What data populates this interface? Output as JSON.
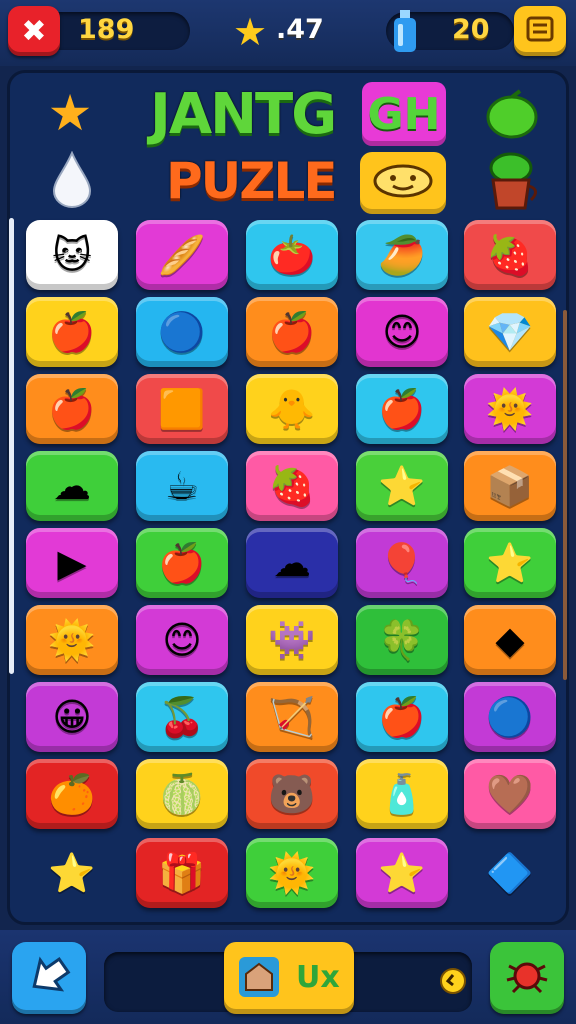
{
  "hud": {
    "coins": "189",
    "stars": ".47",
    "potions": "20",
    "close_icon": "close-x-icon",
    "menu_icon": "menu-icon"
  },
  "title": {
    "line1": "JANTG",
    "line1_box": "GH",
    "line2": "PUZLE"
  },
  "decor": [
    "star-leaf-icon",
    "teardrop-icon",
    "green-fruit-icon",
    "potted-plant-icon",
    "smile-face-badge-icon"
  ],
  "grid": [
    [
      {
        "color": "#ffffff",
        "icon": "cat-face",
        "g": "🐱"
      },
      {
        "color": "#e23ad6",
        "icon": "bread",
        "g": "🥖"
      },
      {
        "color": "#2fc6ee",
        "icon": "tomato",
        "g": "🍅"
      },
      {
        "color": "#37c7ef",
        "icon": "mango",
        "g": "🥭"
      },
      {
        "color": "#f04a4a",
        "icon": "strawberry",
        "g": "🍓"
      }
    ],
    [
      {
        "color": "#ffd21c",
        "icon": "apple",
        "g": "🍎"
      },
      {
        "color": "#25b6f0",
        "icon": "blue-orb",
        "g": "🔵"
      },
      {
        "color": "#ff8d1c",
        "icon": "apple",
        "g": "🍎"
      },
      {
        "color": "#e235d0",
        "icon": "smiley",
        "g": "😊"
      },
      {
        "color": "#ffc11c",
        "icon": "gem",
        "g": "💎"
      }
    ],
    [
      {
        "color": "#ff8d1c",
        "icon": "apple",
        "g": "🍎"
      },
      {
        "color": "#f04a4a",
        "icon": "card",
        "g": "🟧"
      },
      {
        "color": "#ffd21c",
        "icon": "chick",
        "g": "🐥"
      },
      {
        "color": "#2fc6ee",
        "icon": "apple",
        "g": "🍎"
      },
      {
        "color": "#d33ad6",
        "icon": "sun-face",
        "g": "🌞"
      }
    ],
    [
      {
        "color": "#3fcf3a",
        "icon": "cloud",
        "g": "☁"
      },
      {
        "color": "#29baf0",
        "icon": "mug",
        "g": "☕"
      },
      {
        "color": "#ff5aa5",
        "icon": "strawberry",
        "g": "🍓"
      },
      {
        "color": "#49d03a",
        "icon": "star",
        "g": "⭐"
      },
      {
        "color": "#ff8d1c",
        "icon": "box",
        "g": "📦"
      }
    ],
    [
      {
        "color": "#e23ad6",
        "icon": "arrow",
        "g": "▶"
      },
      {
        "color": "#3fcf3a",
        "icon": "apple",
        "g": "🍎"
      },
      {
        "color": "#2a2fa8",
        "icon": "cloud",
        "g": "☁"
      },
      {
        "color": "#c23ad6",
        "icon": "balloon",
        "g": "🎈"
      },
      {
        "color": "#3fcf3a",
        "icon": "star",
        "g": "⭐"
      }
    ],
    [
      {
        "color": "#ff8d1c",
        "icon": "sun-face",
        "g": "🌞"
      },
      {
        "color": "#d33ad6",
        "icon": "smiley",
        "g": "😊"
      },
      {
        "color": "#ffd21c",
        "icon": "blob",
        "g": "👾"
      },
      {
        "color": "#2fbf3a",
        "icon": "clover",
        "g": "🍀"
      },
      {
        "color": "#ff8d1c",
        "icon": "arrow",
        "g": "◆"
      }
    ],
    [
      {
        "color": "#c33ad6",
        "icon": "sun-face",
        "g": "😀"
      },
      {
        "color": "#2fc6ee",
        "icon": "cherry",
        "g": "🍒"
      },
      {
        "color": "#ff8d1c",
        "icon": "bow",
        "g": "🏹"
      },
      {
        "color": "#2fc6ee",
        "icon": "apple",
        "g": "🍎"
      },
      {
        "color": "#c33ad6",
        "icon": "blue-orb",
        "g": "🔵"
      }
    ],
    [
      {
        "color": "#e32424",
        "icon": "orange",
        "g": "🍊"
      },
      {
        "color": "#ffd21c",
        "icon": "lime",
        "g": "🍈"
      },
      {
        "color": "#f04a2a",
        "icon": "bear",
        "g": "🐻"
      },
      {
        "color": "#ffd21c",
        "icon": "bottle",
        "g": "🧴"
      },
      {
        "color": "#ff5aa5",
        "icon": "heart",
        "g": "🤎"
      }
    ],
    [
      {
        "color": "none",
        "icon": "star",
        "g": "⭐"
      },
      {
        "color": "#e32424",
        "icon": "gift",
        "g": "🎁"
      },
      {
        "color": "#3fcf3a",
        "icon": "sun-face",
        "g": "🌞"
      },
      {
        "color": "#d33ad6",
        "icon": "star",
        "g": "⭐"
      },
      {
        "color": "none",
        "icon": "gem",
        "g": "🔷"
      }
    ]
  ],
  "bottom": {
    "back_icon": "back-arrow-icon",
    "tray_left_icon": "house-icon",
    "tray_right_icon": "multiply-icon",
    "tray_mark": "Ux",
    "clock_icon": "clock-icon",
    "settings_icon": "bug-gear-icon"
  },
  "colors": {
    "accent": "#ffd640",
    "close": "#e8222a",
    "back": "#2aa4f0",
    "settings": "#3bc43a"
  }
}
